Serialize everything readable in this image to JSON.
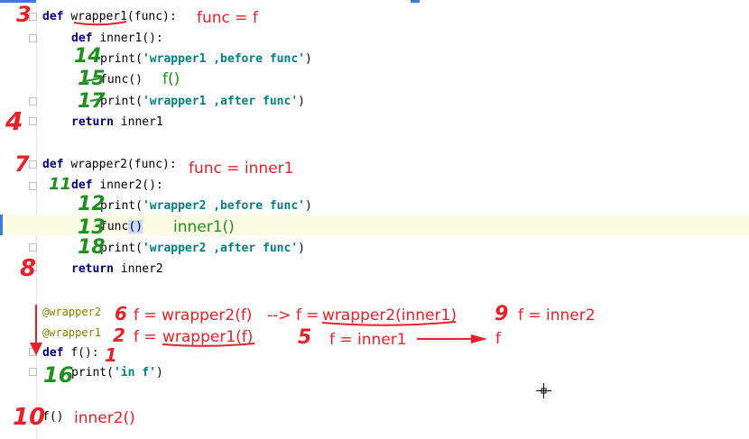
{
  "code": {
    "line1": {
      "kw": "def",
      "rest": "wrapper1(func):"
    },
    "line2": {
      "kw": "def",
      "rest": "inner1():"
    },
    "line3": {
      "pre": "print(",
      "str": "'wrapper1 ,before func'",
      "post": ")"
    },
    "line4": {
      "text": "func()"
    },
    "line5": {
      "pre": "print(",
      "str": "'wrapper1 ,after func'",
      "post": ")"
    },
    "line6": {
      "kw": "return",
      "rest": "inner1"
    },
    "line7": {
      "kw": "def",
      "rest": "wrapper2(func):"
    },
    "line8": {
      "kw": "def",
      "rest": "inner2():"
    },
    "line9": {
      "pre": "print(",
      "str": "'wrapper2 ,before func'",
      "post": ")"
    },
    "line10": {
      "text": "func",
      "sel": "()"
    },
    "line11": {
      "pre": "print(",
      "str": "'wrapper2 ,after func'",
      "post": ")"
    },
    "line12": {
      "kw": "return",
      "rest": "inner2"
    },
    "line13": {
      "deco": "@wrapper2"
    },
    "line14": {
      "deco": "@wrapper1"
    },
    "line15": {
      "kw": "def",
      "rest": "f():"
    },
    "line16": {
      "pre": "print(",
      "str": "'in f'",
      "post": ")"
    },
    "line17": {
      "text": "f()"
    }
  },
  "annotations": {
    "n3": "3",
    "func_eq_f": "func = f",
    "n14": "14",
    "n15": "15",
    "f_call": "f()",
    "n17": "17",
    "n4": "4",
    "n7": "7",
    "func_eq_inner1": "func = inner1",
    "n11": "11",
    "n12": "12",
    "n13": "13",
    "inner1_call": "inner1()",
    "n18": "18",
    "n8": "8",
    "n6": "6",
    "f_eq_wrapper2": "f = wrapper2(f)",
    "arrow_text": "--> f =",
    "wrapper2_inner1": "wrapper2(inner1)",
    "n9": "9",
    "f_eq_inner2": "f = inner2",
    "n2": "2",
    "f_eq": "f =",
    "wrapper1_f": "wrapper1(f)",
    "n5": "5",
    "f_eq_inner1": "f = inner1",
    "f_final": "f",
    "n1": "1",
    "n16": "16",
    "n10": "10",
    "inner2_call": "inner2()"
  },
  "colors": {
    "annotation_red": "#e8202a",
    "annotation_green": "#1f8f1f",
    "keyword": "#000080",
    "string": "#008080",
    "decorator": "#808000"
  }
}
